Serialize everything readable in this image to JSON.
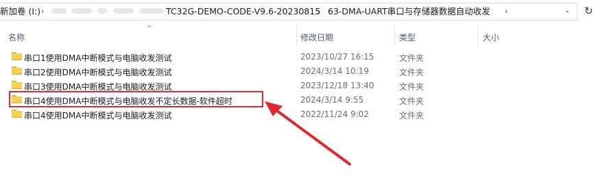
{
  "address": {
    "crumbs": [
      {
        "label": "新加卷 (I:)"
      },
      {
        "label": "TC32G-DEMO-CODE-V9.6-20230815"
      },
      {
        "label": "63-DMA-UART串口与存储器数据自动收发"
      }
    ],
    "dropdown_icon": "chevron-down-icon",
    "refresh_icon": "refresh-icon"
  },
  "columns": {
    "name": "名称",
    "modified": "修改日期",
    "type": "类型",
    "size": "大小"
  },
  "rows": [
    {
      "name": "串口1使用DMA中断模式与电脑收发测试",
      "modified": "2023/10/27 16:15",
      "type": "文件夹"
    },
    {
      "name": "串口2使用DMA中断模式与电脑收发测试",
      "modified": "2024/3/14 10:19",
      "type": "文件夹"
    },
    {
      "name": "串口3使用DMA中断模式与电脑收发测试",
      "modified": "2023/12/18 13:40",
      "type": "文件夹"
    },
    {
      "name": "串口4使用DMA中断模式与电脑收发不定长数据-软件超时",
      "modified": "2024/3/14 9:55",
      "type": "文件夹"
    },
    {
      "name": "串口4使用DMA中断模式与电脑收发测试",
      "modified": "2022/11/24 9:02",
      "type": "文件夹"
    }
  ],
  "annotation": {
    "highlight_color": "#e0282e",
    "arrow_color": "#e0282e"
  }
}
